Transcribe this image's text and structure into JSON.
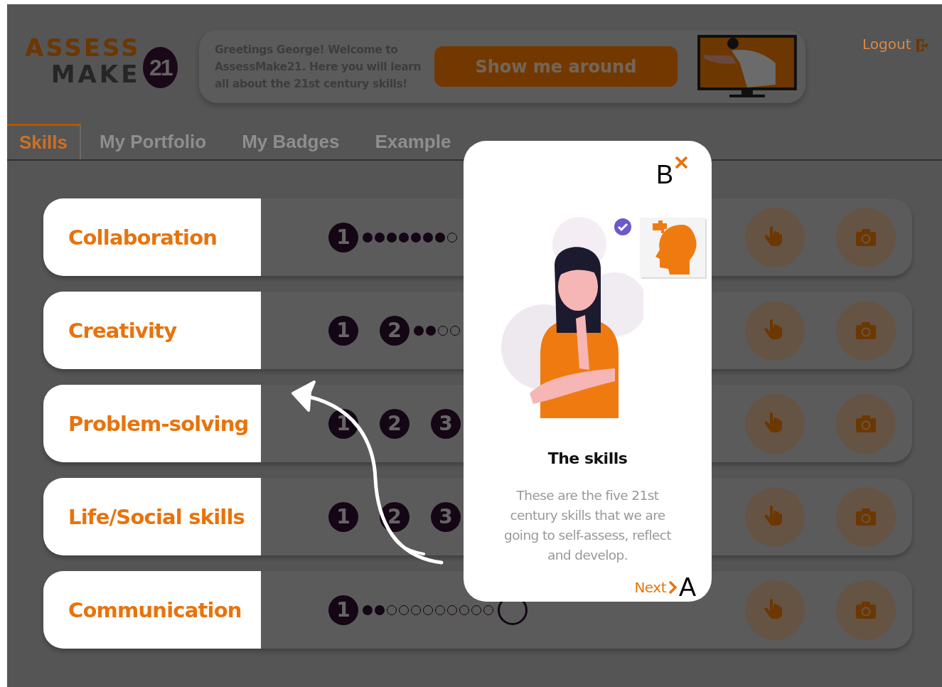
{
  "logo": {
    "line_1": "ASSESS",
    "line_2": "MAKE",
    "badge": "21"
  },
  "greeting": {
    "message": "Greetings George! Welcome to AssessMake21. Here you will learn all about the 21st century skills!",
    "button": "Show me around"
  },
  "logout": "Logout",
  "tabs": [
    {
      "label": "Skills",
      "selected": true
    },
    {
      "label": "My Portfolio",
      "selected": false
    },
    {
      "label": "My Badges",
      "selected": false
    },
    {
      "label": "Example",
      "selected": false
    }
  ],
  "skills": [
    {
      "name": "Collaboration",
      "progress": [
        {
          "kind": "step",
          "label": "1",
          "completed": true
        },
        {
          "kind": "dot",
          "filled": true
        },
        {
          "kind": "dot",
          "filled": true
        },
        {
          "kind": "dot",
          "filled": true
        },
        {
          "kind": "dot",
          "filled": true
        },
        {
          "kind": "dot",
          "filled": true
        },
        {
          "kind": "dot",
          "filled": true
        },
        {
          "kind": "dot",
          "filled": true
        },
        {
          "kind": "dot",
          "filled": false
        }
      ]
    },
    {
      "name": "Creativity",
      "progress": [
        {
          "kind": "step",
          "label": "1",
          "completed": true
        },
        {
          "kind": "step",
          "label": "2",
          "completed": true
        },
        {
          "kind": "dot",
          "filled": true
        },
        {
          "kind": "dot",
          "filled": true
        },
        {
          "kind": "dot",
          "filled": false
        },
        {
          "kind": "dot",
          "filled": false
        }
      ]
    },
    {
      "name": "Problem-solving",
      "progress": [
        {
          "kind": "step",
          "label": "1",
          "completed": true
        },
        {
          "kind": "step",
          "label": "2",
          "completed": true
        },
        {
          "kind": "step",
          "label": "3",
          "completed": true
        }
      ]
    },
    {
      "name": "Life/Social skills",
      "progress": [
        {
          "kind": "step",
          "label": "1",
          "completed": true
        },
        {
          "kind": "step",
          "label": "2",
          "completed": true
        },
        {
          "kind": "step",
          "label": "3",
          "completed": true
        }
      ]
    },
    {
      "name": "Communication",
      "progress": [
        {
          "kind": "step",
          "label": "1",
          "completed": true
        },
        {
          "kind": "dot",
          "filled": true
        },
        {
          "kind": "dot",
          "filled": true
        },
        {
          "kind": "dot",
          "filled": false
        },
        {
          "kind": "dot",
          "filled": false
        },
        {
          "kind": "dot",
          "filled": false
        },
        {
          "kind": "dot",
          "filled": false
        },
        {
          "kind": "dot",
          "filled": false
        },
        {
          "kind": "dot",
          "filled": false
        },
        {
          "kind": "dot",
          "filled": false
        },
        {
          "kind": "dot",
          "filled": false
        },
        {
          "kind": "dot",
          "filled": false
        },
        {
          "kind": "step",
          "completed": false
        }
      ]
    }
  ],
  "tour_popup": {
    "title": "The skills",
    "body": "These are the five 21st century skills that we are going to self-assess, reflect and develop.",
    "next": "Next",
    "close_callout": "B",
    "next_callout": "A"
  }
}
